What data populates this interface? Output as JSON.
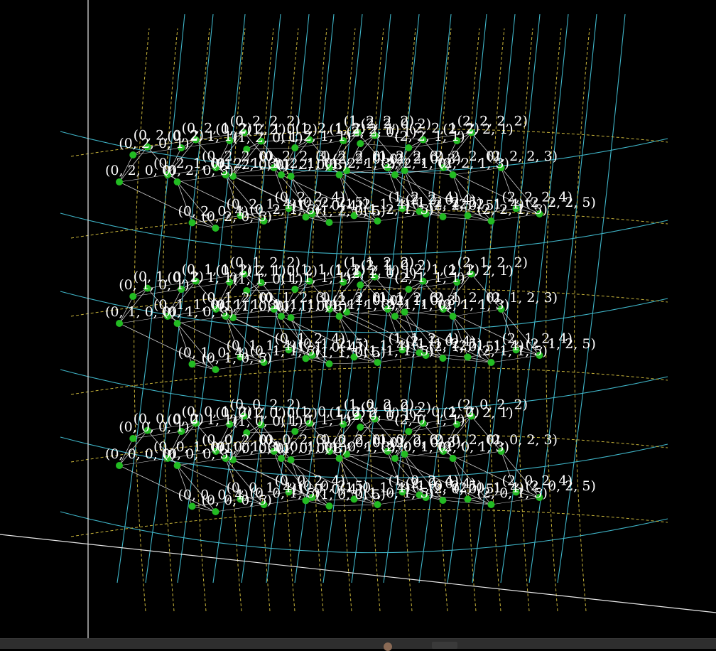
{
  "colors": {
    "background": "#000000",
    "node": "#22bb22",
    "edge": "#cfcfcf",
    "curve_solid": "#3fb5c8",
    "curve_dashed": "#c8b43a",
    "axis": "#e8e8e8",
    "label": "#ffffff"
  },
  "nodes": [
    {
      "label": "(0, 0, 0, 0)"
    },
    {
      "label": "(0, 0, 0, 1)"
    },
    {
      "label": "(0, 0, 0, 2)"
    },
    {
      "label": "(0, 0, 0, 3)"
    },
    {
      "label": "(0, 0, 0, 4)"
    },
    {
      "label": "(0, 0, 0, 5)"
    },
    {
      "label": "(0, 0, 1, 0)"
    },
    {
      "label": "(0, 0, 1, 1)"
    },
    {
      "label": "(0, 0, 1, 2)"
    },
    {
      "label": "(0, 0, 1, 3)"
    },
    {
      "label": "(0, 0, 1, 4)"
    },
    {
      "label": "(0, 0, 1, 5)"
    },
    {
      "label": "(0, 0, 2, 0)"
    },
    {
      "label": "(0, 0, 2, 1)"
    },
    {
      "label": "(0, 0, 2, 2)"
    },
    {
      "label": "(0, 0, 2, 3)"
    },
    {
      "label": "(0, 0, 2, 4)"
    },
    {
      "label": "(0, 0, 2, 5)"
    },
    {
      "label": "(1, 0, 0, 0)"
    },
    {
      "label": "(1, 0, 0, 1)"
    },
    {
      "label": "(1, 0, 0, 2)"
    },
    {
      "label": "(1, 0, 0, 3)"
    },
    {
      "label": "(1, 0, 0, 4)"
    },
    {
      "label": "(1, 0, 0, 5)"
    },
    {
      "label": "(1, 0, 1, 0)"
    },
    {
      "label": "(1, 0, 1, 1)"
    },
    {
      "label": "(1, 0, 1, 2)"
    },
    {
      "label": "(1, 0, 1, 3)"
    },
    {
      "label": "(1, 0, 1, 4)"
    },
    {
      "label": "(1, 0, 1, 5)"
    },
    {
      "label": "(1, 0, 2, 0)"
    },
    {
      "label": "(1, 0, 2, 1)"
    },
    {
      "label": "(1, 0, 2, 2)"
    },
    {
      "label": "(1, 0, 2, 3)"
    },
    {
      "label": "(1, 0, 2, 4)"
    },
    {
      "label": "(1, 0, 2, 5)"
    },
    {
      "label": "(2, 0, 0, 0)"
    },
    {
      "label": "(2, 0, 0, 1)"
    },
    {
      "label": "(2, 0, 0, 2)"
    },
    {
      "label": "(2, 0, 0, 3)"
    },
    {
      "label": "(2, 0, 0, 4)"
    },
    {
      "label": "(2, 0, 0, 5)"
    },
    {
      "label": "(2, 0, 1, 0)"
    },
    {
      "label": "(2, 0, 1, 1)"
    },
    {
      "label": "(2, 0, 1, 2)"
    },
    {
      "label": "(2, 0, 1, 3)"
    },
    {
      "label": "(2, 0, 1, 4)"
    },
    {
      "label": "(2, 0, 1, 5)"
    },
    {
      "label": "(2, 0, 2, 0)"
    },
    {
      "label": "(2, 0, 2, 1)"
    },
    {
      "label": "(2, 0, 2, 2)"
    },
    {
      "label": "(2, 0, 2, 3)"
    },
    {
      "label": "(2, 0, 2, 4)"
    },
    {
      "label": "(2, 0, 2, 5)"
    },
    {
      "label": "(0, 1, 0, 0)"
    },
    {
      "label": "(0, 1, 0, 1)"
    },
    {
      "label": "(0, 1, 0, 2)"
    },
    {
      "label": "(0, 1, 0, 3)"
    },
    {
      "label": "(0, 1, 0, 4)"
    },
    {
      "label": "(0, 1, 0, 5)"
    },
    {
      "label": "(0, 1, 1, 0)"
    },
    {
      "label": "(0, 1, 1, 1)"
    },
    {
      "label": "(0, 1, 1, 2)"
    },
    {
      "label": "(0, 1, 1, 3)"
    },
    {
      "label": "(0, 1, 1, 4)"
    },
    {
      "label": "(0, 1, 1, 5)"
    },
    {
      "label": "(0, 1, 2, 0)"
    },
    {
      "label": "(0, 1, 2, 1)"
    },
    {
      "label": "(0, 1, 2, 2)"
    },
    {
      "label": "(0, 1, 2, 3)"
    },
    {
      "label": "(0, 1, 2, 4)"
    },
    {
      "label": "(0, 1, 2, 5)"
    },
    {
      "label": "(1, 1, 0, 0)"
    },
    {
      "label": "(1, 1, 0, 1)"
    },
    {
      "label": "(1, 1, 0, 2)"
    },
    {
      "label": "(1, 1, 0, 3)"
    },
    {
      "label": "(1, 1, 0, 4)"
    },
    {
      "label": "(1, 1, 0, 5)"
    },
    {
      "label": "(1, 1, 1, 0)"
    },
    {
      "label": "(1, 1, 1, 1)"
    },
    {
      "label": "(1, 1, 1, 2)"
    },
    {
      "label": "(1, 1, 1, 3)"
    },
    {
      "label": "(1, 1, 1, 4)"
    },
    {
      "label": "(1, 1, 1, 5)"
    },
    {
      "label": "(1, 1, 2, 0)"
    },
    {
      "label": "(1, 1, 2, 1)"
    },
    {
      "label": "(1, 1, 2, 2)"
    },
    {
      "label": "(1, 1, 2, 3)"
    },
    {
      "label": "(1, 1, 2, 4)"
    },
    {
      "label": "(1, 1, 2, 5)"
    },
    {
      "label": "(2, 1, 0, 0)"
    },
    {
      "label": "(2, 1, 0, 1)"
    },
    {
      "label": "(2, 1, 0, 2)"
    },
    {
      "label": "(2, 1, 0, 3)"
    },
    {
      "label": "(2, 1, 0, 4)"
    },
    {
      "label": "(2, 1, 0, 5)"
    },
    {
      "label": "(2, 1, 1, 0)"
    },
    {
      "label": "(2, 1, 1, 1)"
    },
    {
      "label": "(2, 1, 1, 2)"
    },
    {
      "label": "(2, 1, 1, 3)"
    },
    {
      "label": "(2, 1, 1, 4)"
    },
    {
      "label": "(2, 1, 1, 5)"
    },
    {
      "label": "(2, 1, 2, 0)"
    },
    {
      "label": "(2, 1, 2, 1)"
    },
    {
      "label": "(2, 1, 2, 2)"
    },
    {
      "label": "(2, 1, 2, 3)"
    },
    {
      "label": "(2, 1, 2, 4)"
    },
    {
      "label": "(2, 1, 2, 5)"
    },
    {
      "label": "(0, 2, 0, 0)"
    },
    {
      "label": "(0, 2, 0, 1)"
    },
    {
      "label": "(0, 2, 0, 2)"
    },
    {
      "label": "(0, 2, 0, 3)"
    },
    {
      "label": "(0, 2, 0, 4)"
    },
    {
      "label": "(0, 2, 0, 5)"
    },
    {
      "label": "(0, 2, 1, 0)"
    },
    {
      "label": "(0, 2, 1, 1)"
    },
    {
      "label": "(0, 2, 1, 2)"
    },
    {
      "label": "(0, 2, 1, 3)"
    },
    {
      "label": "(0, 2, 1, 4)"
    },
    {
      "label": "(0, 2, 1, 5)"
    },
    {
      "label": "(0, 2, 2, 0)"
    },
    {
      "label": "(0, 2, 2, 1)"
    },
    {
      "label": "(0, 2, 2, 2)"
    },
    {
      "label": "(0, 2, 2, 3)"
    },
    {
      "label": "(0, 2, 2, 4)"
    },
    {
      "label": "(0, 2, 2, 5)"
    },
    {
      "label": "(1, 2, 0, 0)"
    },
    {
      "label": "(1, 2, 0, 1)"
    },
    {
      "label": "(1, 2, 0, 2)"
    },
    {
      "label": "(1, 2, 0, 3)"
    },
    {
      "label": "(1, 2, 0, 4)"
    },
    {
      "label": "(1, 2, 0, 5)"
    },
    {
      "label": "(1, 2, 1, 0)"
    },
    {
      "label": "(1, 2, 1, 1)"
    },
    {
      "label": "(1, 2, 1, 2)"
    },
    {
      "label": "(1, 2, 1, 3)"
    },
    {
      "label": "(1, 2, 1, 4)"
    },
    {
      "label": "(1, 2, 1, 5)"
    },
    {
      "label": "(1, 2, 2, 0)"
    },
    {
      "label": "(1, 2, 2, 1)"
    },
    {
      "label": "(1, 2, 2, 2)"
    },
    {
      "label": "(1, 2, 2, 3)"
    },
    {
      "label": "(1, 2, 2, 4)"
    },
    {
      "label": "(1, 2, 2, 5)"
    },
    {
      "label": "(2, 2, 0, 0)"
    },
    {
      "label": "(2, 2, 0, 1)"
    },
    {
      "label": "(2, 2, 0, 2)"
    },
    {
      "label": "(2, 2, 0, 3)"
    },
    {
      "label": "(2, 2, 0, 4)"
    },
    {
      "label": "(2, 2, 0, 5)"
    },
    {
      "label": "(2, 2, 1, 0)"
    },
    {
      "label": "(2, 2, 1, 1)"
    },
    {
      "label": "(2, 2, 1, 2)"
    },
    {
      "label": "(2, 2, 1, 3)"
    },
    {
      "label": "(2, 2, 1, 4)"
    },
    {
      "label": "(2, 2, 1, 5)"
    },
    {
      "label": "(2, 2, 2, 0)"
    },
    {
      "label": "(2, 2, 2, 1)"
    },
    {
      "label": "(2, 2, 2, 2)"
    },
    {
      "label": "(2, 2, 2, 3)"
    },
    {
      "label": "(2, 2, 2, 4)"
    },
    {
      "label": "(2, 2, 2, 5)"
    }
  ]
}
